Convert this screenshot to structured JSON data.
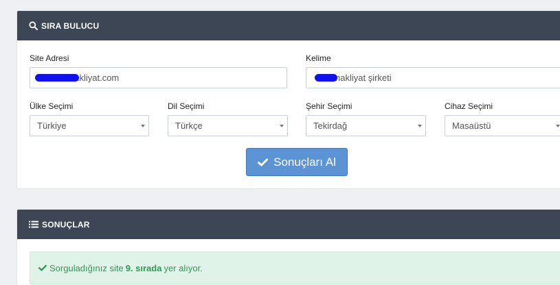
{
  "finder": {
    "title": "SIRA BULUCU",
    "site": {
      "label": "Site Adresi",
      "value": "nakliyat.com"
    },
    "keyword": {
      "label": "Kelime",
      "value": "nakliyat şirketi"
    },
    "country": {
      "label": "Ülke Seçimi",
      "value": "Türkiye"
    },
    "language": {
      "label": "Dil Seçimi",
      "value": "Türkçe"
    },
    "city": {
      "label": "Şehir Seçimi",
      "value": "Tekirdağ"
    },
    "device": {
      "label": "Cihaz Seçimi",
      "value": "Masaüstü"
    },
    "submit_label": "Sonuçları Al"
  },
  "results": {
    "title": "SONUÇLAR",
    "message_prefix": "Sorguladığınız site",
    "rank": "9. sırada",
    "message_suffix": "yer alıyor."
  },
  "colors": {
    "header_bg": "#3d4654",
    "button_bg": "#5b93d3",
    "success_bg": "#e0f3e8",
    "success_text": "#2f9a55"
  },
  "icons": {
    "finder": "search-icon",
    "results": "list-icon",
    "submit": "check-icon",
    "alert": "check-icon"
  }
}
